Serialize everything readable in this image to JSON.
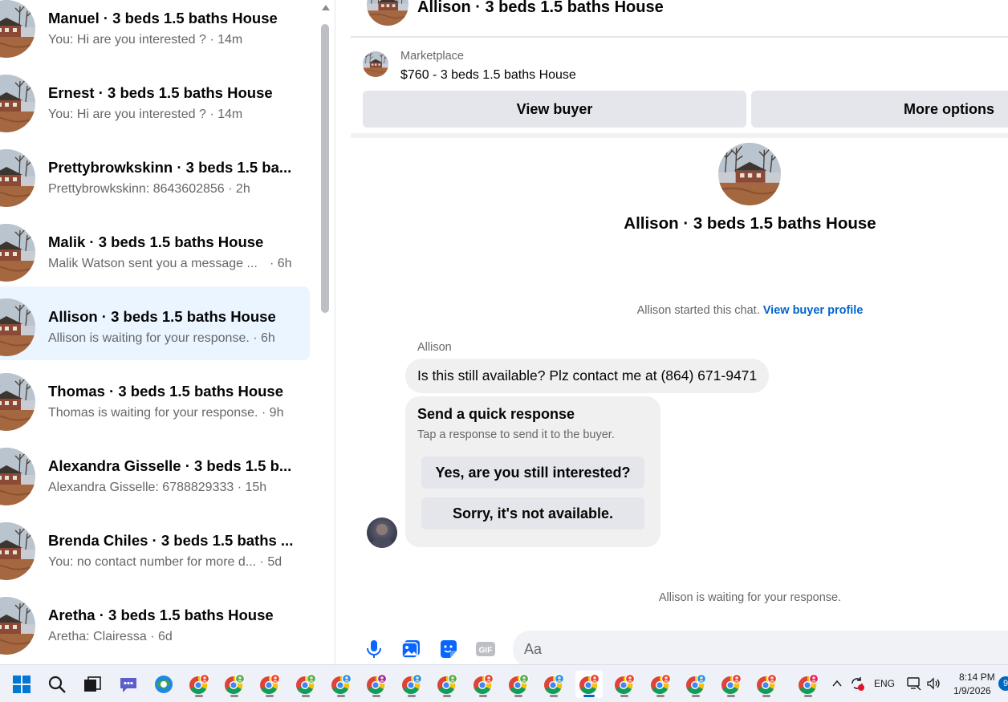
{
  "conversations": [
    {
      "title": "Manuel · 3 beds 1.5 baths House",
      "preview": "You: Hi are you interested ? · 14m",
      "time": ""
    },
    {
      "title": "Ernest · 3 beds 1.5 baths House",
      "preview": "You: Hi are you interested ? · 14m",
      "time": ""
    },
    {
      "title": "Prettybrowkskinn · 3 beds 1.5 ba...",
      "preview": "Prettybrowkskinn: 8643602856 · 2h",
      "time": ""
    },
    {
      "title": "Malik · 3 beds 1.5 baths House",
      "preview": "Malik Watson sent you a message ...",
      "time": "· 6h"
    },
    {
      "title": "Allison · 3 beds 1.5 baths House",
      "preview": "Allison is waiting for your response. · 6h",
      "time": "",
      "active": true
    },
    {
      "title": "Thomas · 3 beds 1.5 baths House",
      "preview": "Thomas is waiting for your response. · 9h",
      "time": ""
    },
    {
      "title": "Alexandra Gisselle · 3 beds 1.5 b...",
      "preview": "Alexandra Gisselle: 6788829333 · 15h",
      "time": ""
    },
    {
      "title": "Brenda Chiles · 3 beds 1.5 baths ...",
      "preview": "You: no contact number for more d... · 5d",
      "time": ""
    },
    {
      "title": "Aretha · 3 beds 1.5 baths House",
      "preview": "Aretha: Clairessa · 6d",
      "time": ""
    }
  ],
  "chat": {
    "header_title": "Allison · 3 beds 1.5 baths House",
    "listing_kind": "Marketplace",
    "listing_title": "$760 - 3 beds 1.5 baths House",
    "view_buyer_label": "View buyer",
    "more_options_label": "More options",
    "hero_title": "Allison · 3 beds 1.5 baths House",
    "started_text": "Allison started this chat.",
    "view_profile_link": "View buyer profile",
    "sender_name": "Allison",
    "message": "Is this still available? Plz contact me at (864) 671-9471",
    "quick_title": "Send a quick response",
    "quick_sub": "Tap a response to send it to the buyer.",
    "quick_yes": "Yes, are you still interested?",
    "quick_no": "Sorry, it's not available.",
    "waiting_text": "Allison is waiting for your response.",
    "composer_placeholder": "Aa"
  },
  "composer_icons": [
    "microphone-icon",
    "photo-icon",
    "sticker-icon",
    "gif-icon"
  ],
  "taskbar": {
    "apps": [
      "start",
      "search",
      "task-view",
      "teams-chat",
      "edge",
      "chrome-profile-1",
      "chrome-profile-2",
      "chrome-profile-3",
      "chrome-profile-4",
      "chrome-profile-5",
      "chrome-profile-6",
      "chrome-profile-7",
      "chrome-profile-8",
      "chrome-profile-9",
      "chrome-profile-10",
      "chrome-profile-11",
      "chrome-profile-12",
      "chrome-profile-13",
      "chrome-profile-14",
      "chrome-profile-15",
      "chrome-profile-16",
      "chrome-profile-17",
      "chrome-profile-18"
    ],
    "language": "ENG",
    "time": "8:14 PM",
    "date": "1/9/2026",
    "notification_count": "9"
  },
  "colors": {
    "accent": "#0064d1",
    "active_row": "#ebf5ff",
    "bubble": "#f0f0f0",
    "button": "#e4e6eb",
    "muted_text": "#65676b",
    "messenger_blue": "#0866ff"
  }
}
